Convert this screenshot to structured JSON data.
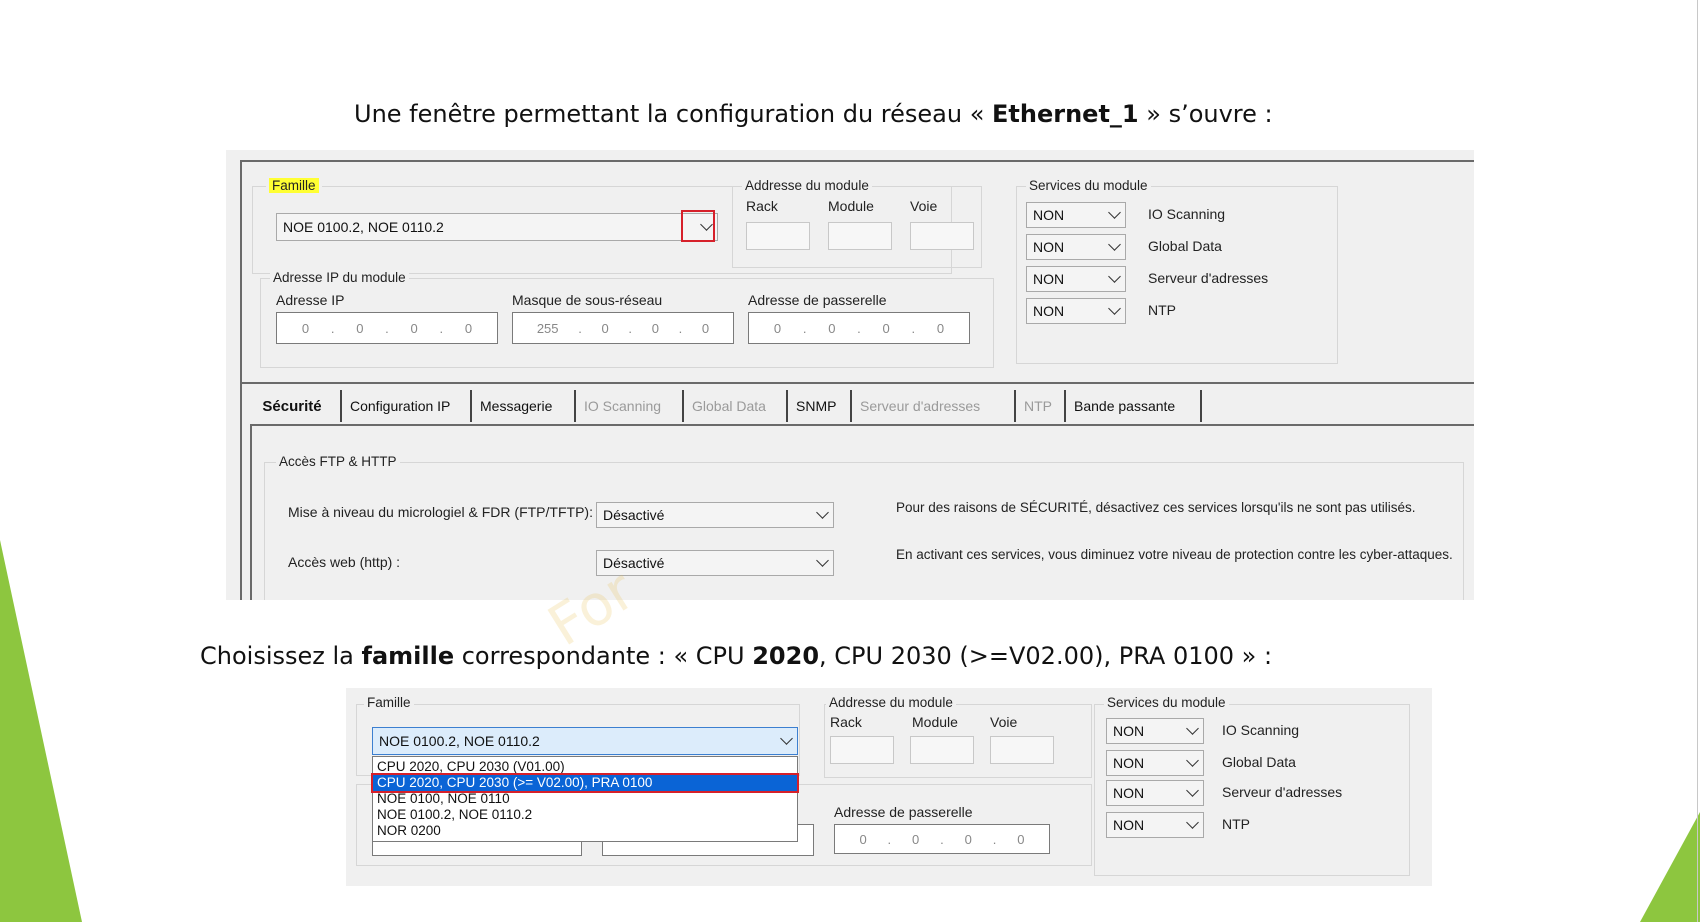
{
  "slide": {
    "intro_before": "Une fenêtre permettant la configuration du réseau « ",
    "intro_bold": "Ethernet_1",
    "intro_after": " » s’ouvre :",
    "choose_1": "Choisissez la ",
    "choose_bold1": "famille",
    "choose_2": " correspondante : « CPU ",
    "choose_bold2": "2020",
    "choose_3": ", CPU 2030 (>=V02.00), PRA 0100 » :",
    "watermark": "For",
    "accent_color": "#8dc63f"
  },
  "config": {
    "famille_label": "Famille",
    "famille_value": "NOE 0100.2, NOE 0110.2",
    "module_addr_title": "Addresse du module",
    "rack_label": "Rack",
    "module_label": "Module",
    "voie_label": "Voie",
    "ip_group_title": "Adresse IP du module",
    "ip_label": "Adresse IP",
    "mask_label": "Masque de sous-réseau",
    "gateway_label": "Adresse de passerelle",
    "ip_value": [
      "0",
      "0",
      "0",
      "0"
    ],
    "mask_value": [
      "255",
      "0",
      "0",
      "0"
    ],
    "gateway_value": [
      "0",
      "0",
      "0",
      "0"
    ],
    "services_title": "Services du module",
    "services": [
      {
        "value": "NON",
        "label": "IO Scanning"
      },
      {
        "value": "NON",
        "label": "Global Data"
      },
      {
        "value": "NON",
        "label": "Serveur d'adresses"
      },
      {
        "value": "NON",
        "label": "NTP"
      }
    ],
    "tabs": [
      {
        "label": "Sécurité",
        "state": "active"
      },
      {
        "label": "Configuration IP",
        "state": "normal"
      },
      {
        "label": "Messagerie",
        "state": "normal"
      },
      {
        "label": "IO Scanning",
        "state": "disabled"
      },
      {
        "label": "Global Data",
        "state": "disabled"
      },
      {
        "label": "SNMP",
        "state": "normal"
      },
      {
        "label": "Serveur d'adresses",
        "state": "disabled"
      },
      {
        "label": "NTP",
        "state": "disabled"
      },
      {
        "label": "Bande passante",
        "state": "normal"
      }
    ],
    "access_title": "Accès FTP & HTTP",
    "firmware_label": "Mise à niveau du micrologiel & FDR (FTP/TFTP):",
    "firmware_value": "Désactivé",
    "web_label": "Accès web (http) :",
    "web_value": "Désactivé",
    "security_note": "Pour des raisons de SÉCURITÉ, désactivez ces services lorsqu'ils ne sont pas utilisés.",
    "cyber_note": "En activant ces services, vous diminuez votre niveau de protection contre les cyber-attaques."
  },
  "choice": {
    "famille_label": "Famille",
    "famille_value": "NOE 0100.2, NOE 0110.2",
    "options": [
      "CPU 2020, CPU 2030 (V01.00)",
      "CPU 2020, CPU 2030 (>= V02.00), PRA 0100",
      "NOE 0100, NOE 0110",
      "NOE 0100.2, NOE 0110.2",
      "NOR 0200"
    ],
    "selected_index": 1,
    "module_addr_title": "Addresse du module",
    "rack_label": "Rack",
    "module_label": "Module",
    "voie_label": "Voie",
    "gateway_label": "Adresse de passerelle",
    "gateway_value": [
      "0",
      "0",
      "0",
      "0"
    ],
    "services_title": "Services du module",
    "services": [
      {
        "value": "NON",
        "label": "IO Scanning"
      },
      {
        "value": "NON",
        "label": "Global Data"
      },
      {
        "value": "NON",
        "label": "Serveur d'adresses"
      },
      {
        "value": "NON",
        "label": "NTP"
      }
    ]
  }
}
